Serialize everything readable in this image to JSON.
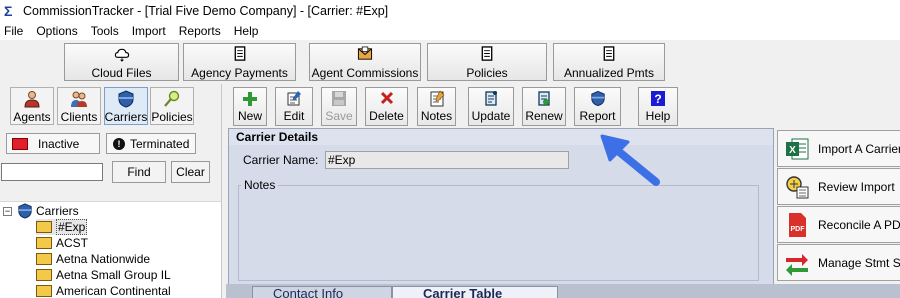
{
  "window": {
    "title": "CommissionTracker - [Trial Five Demo Company] - [Carrier: #Exp]",
    "app_icon": "Σ"
  },
  "menu": [
    "File",
    "Options",
    "Tools",
    "Import",
    "Reports",
    "Help"
  ],
  "top_buttons": [
    {
      "label": "Cloud Files",
      "icon": "cloud-files-icon"
    },
    {
      "label": "Agency Payments",
      "icon": "document-icon"
    },
    {
      "label": "Agent Commissions",
      "icon": "envelope-icon"
    },
    {
      "label": "Policies",
      "icon": "document-icon"
    },
    {
      "label": "Annualized Pmts",
      "icon": "document-icon"
    }
  ],
  "nav_buttons": [
    {
      "label": "Agents",
      "icon": "agent-icon"
    },
    {
      "label": "Clients",
      "icon": "clients-icon"
    },
    {
      "label": "Carriers",
      "icon": "carrier-shield-icon",
      "active": true
    },
    {
      "label": "Policies",
      "icon": "magnifier-icon"
    }
  ],
  "filters": {
    "inactive": "Inactive",
    "terminated": "Terminated"
  },
  "search": {
    "value": "",
    "find": "Find",
    "clear": "Clear"
  },
  "tree": {
    "root": "Carriers",
    "items": [
      "#Exp",
      "ACST",
      "Aetna Nationwide",
      "Aetna Small Group IL",
      "American Continental"
    ]
  },
  "toolbar": [
    {
      "label": "New",
      "icon": "plus-icon"
    },
    {
      "label": "Edit",
      "icon": "edit-icon"
    },
    {
      "label": "Save",
      "icon": "save-icon",
      "disabled": true
    },
    {
      "label": "Delete",
      "icon": "delete-icon"
    },
    {
      "label": "Notes",
      "icon": "notes-icon"
    },
    {
      "label": "Update",
      "icon": "scroll-icon"
    },
    {
      "label": "Renew",
      "icon": "renew-icon"
    },
    {
      "label": "Report",
      "icon": "shield-icon"
    },
    {
      "label": "Help",
      "icon": "help-icon"
    }
  ],
  "details": {
    "heading": "Carrier Details",
    "carrier_name_label": "Carrier Name:",
    "carrier_name_value": "#Exp",
    "notes_label": "Notes"
  },
  "side_actions": [
    {
      "label": "Import A Carrier",
      "icon": "excel-icon"
    },
    {
      "label": "Review Import",
      "icon": "review-icon"
    },
    {
      "label": "Reconcile A PDF",
      "icon": "pdf-icon"
    },
    {
      "label": "Manage Stmt Se",
      "icon": "swap-arrows-icon"
    }
  ],
  "tabs": [
    {
      "label": "Contact Info",
      "active": false
    },
    {
      "label": "Carrier Table",
      "active": true
    }
  ],
  "colors": {
    "accent": "#3d6fe6",
    "panel": "#d6dbe9",
    "tab_strip": "#b9c0cf"
  }
}
